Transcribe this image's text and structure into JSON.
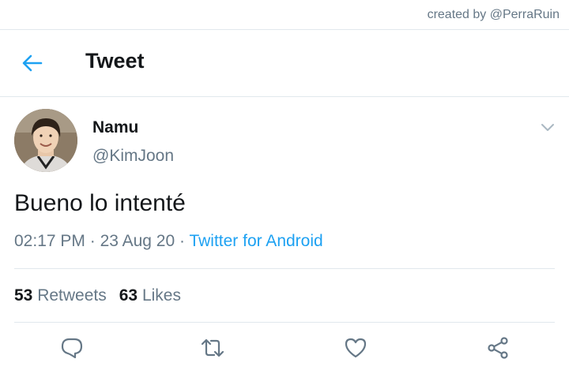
{
  "watermark": "created by @PerraRuin",
  "header": {
    "title": "Tweet",
    "back_icon": "arrow-left-icon"
  },
  "tweet": {
    "display_name": "Namu",
    "handle": "@KimJoon",
    "text": "Bueno lo intenté",
    "time": "02:17 PM",
    "separator": " · ",
    "date": "23 Aug 20",
    "source": "Twitter for Android"
  },
  "stats": {
    "retweets_count": "53",
    "retweets_label": "Retweets",
    "likes_count": "63",
    "likes_label": "Likes"
  },
  "actions": [
    "reply-icon",
    "retweet-icon",
    "like-icon",
    "share-icon"
  ],
  "colors": {
    "accent": "#1da1f2",
    "secondary_text": "#657786",
    "divider": "#e1e8ed"
  }
}
